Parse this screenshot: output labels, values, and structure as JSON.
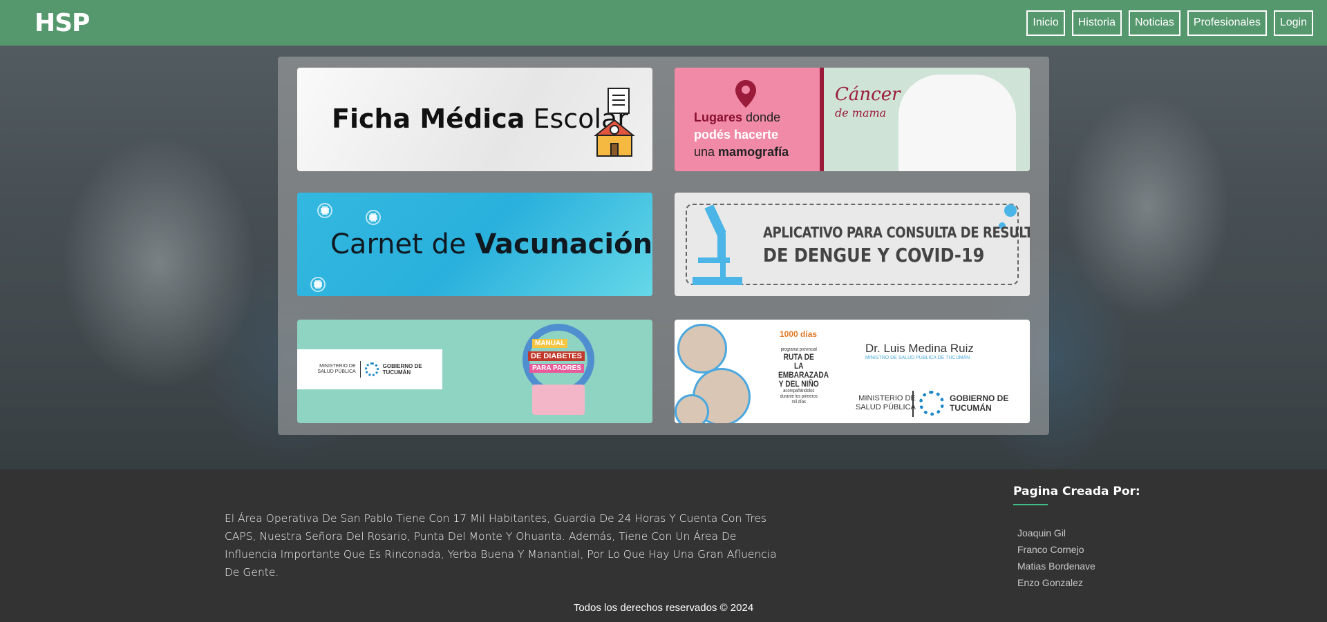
{
  "navbar": {
    "logo": "HSP",
    "links": [
      "Inicio",
      "Historia",
      "Noticias",
      "Profesionales",
      "Login"
    ]
  },
  "banners": {
    "ficha": {
      "bold": "Ficha Médica",
      "rest": " Escolar"
    },
    "mamografia": {
      "l1a": "Lugares",
      "l1b": " donde",
      "l2": "podés hacerte",
      "l3a": "una ",
      "l3b": "mamografía",
      "brand1": "Cáncer",
      "brand2": "de mama"
    },
    "vacunacion": {
      "light": "Carnet de ",
      "bold": "Vacunación"
    },
    "dengue": {
      "line1": "APLICATIVO PARA CONSULTA DE RESULTADO",
      "line2": "DE DENGUE Y COVID-19"
    },
    "diabetes": {
      "ministerio1": "MINISTERIO DE",
      "ministerio2": "SALUD PÚBLICA",
      "gobierno1": "GOBIERNO DE",
      "gobierno2": "TUCUMÁN",
      "manual": "MANUAL",
      "de_diabetes": "DE DIABETES",
      "para_padres": "PARA PADRES"
    },
    "embarazada": {
      "dias": "1000 días",
      "programa": "programa provincial",
      "ruta": "RUTA DE LA EMBARAZADA Y DEL NIÑO",
      "acomp": "acompañándolos durante los primeros mil días",
      "dr": "Dr. Luis Medina Ruiz",
      "drsub": "MINISTRO DE SALUD PÚBLICA DE TUCUMÁN",
      "min1": "MINISTERIO DE",
      "min2": "SALUD PÚBLICA",
      "gob1": "GOBIERNO DE",
      "gob2": "TUCUMÁN"
    }
  },
  "footer": {
    "about": "El Área Operativa De San Pablo Tiene Con 17 Mil Habitantes, Guardia De 24 Horas Y Cuenta Con Tres CAPS, Nuestra Señora Del Rosario, Punta Del Monte Y Ohuanta. Además, Tiene Con Un Área De Influencia Importante Que Es Rinconada, Yerba Buena Y Manantial, Por Lo Que Hay Una Gran Afluencia De Gente.",
    "credits_title": "Pagina Creada Por:",
    "credits": [
      "Joaquin Gil",
      "Franco Cornejo",
      "Matias Bordenave",
      "Enzo Gonzalez"
    ],
    "copyright": "Todos los derechos reservados © 2024"
  },
  "colors": {
    "navbar": "#56a06e",
    "footer": "#333333",
    "accent_line": "#3fbf83"
  }
}
